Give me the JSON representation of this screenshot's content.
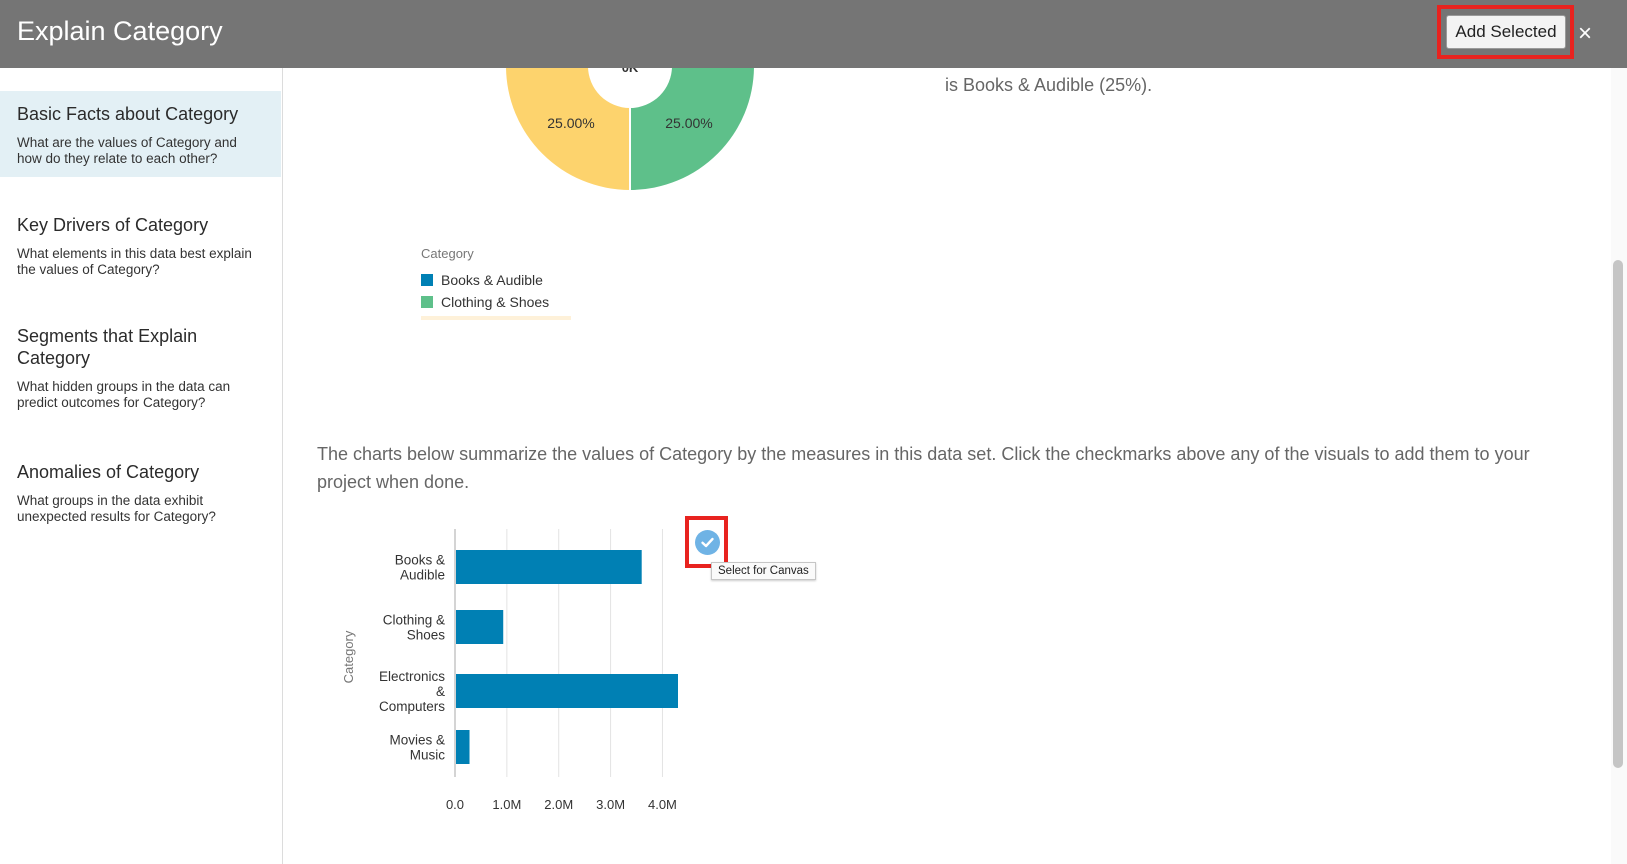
{
  "header": {
    "title": "Explain Category",
    "add_selected_label": "Add Selected",
    "close_label": "×"
  },
  "sidebar": {
    "items": [
      {
        "title": "Basic Facts about Category",
        "desc": "What are the values of Category and how do they relate to each other?",
        "active": true
      },
      {
        "title": "Key Drivers of Category",
        "desc": "What elements in this data best explain the values of Category?",
        "active": false
      },
      {
        "title": "Segments that Explain Category",
        "desc": "What hidden groups in the data can predict outcomes for Category?",
        "active": false
      },
      {
        "title": "Anomalies of Category",
        "desc": "What groups in the data exhibit unexpected results for Category?",
        "active": false
      }
    ]
  },
  "pie": {
    "center_label": "0K",
    "slice_labels": [
      "25.00%",
      "25.00%"
    ],
    "summary_text": "is Books & Audible (25%).",
    "legend_title": "Category",
    "legend": [
      {
        "label": "Books & Audible",
        "color": "#0080b4"
      },
      {
        "label": "Clothing & Shoes",
        "color": "#5ec08a"
      }
    ],
    "colors": {
      "yellow": "#fdd36d",
      "green": "#5ec08a"
    }
  },
  "description": "The charts below summarize the values of Category by the measures in this data set. Click the checkmarks above any of the visuals to add them to your project when done.",
  "select_tooltip": "Select for Canvas",
  "chart_data": {
    "type": "bar",
    "orientation": "horizontal",
    "categories": [
      "Books & Audible",
      "Clothing & Shoes",
      "Electronics & Computers",
      "Movies & Music"
    ],
    "category_label_lines": [
      [
        "Books &",
        "Audible"
      ],
      [
        "Clothing &",
        "Shoes"
      ],
      [
        "Electronics",
        "&",
        "Computers"
      ],
      [
        "Movies &",
        "Music"
      ]
    ],
    "values": [
      3.6,
      0.93,
      4.3,
      0.28
    ],
    "value_unit": "M",
    "ylabel": "Category",
    "xlim": [
      0,
      4.3
    ],
    "ticks": [
      "0.0",
      "1.0M",
      "2.0M",
      "3.0M",
      "4.0M"
    ],
    "tick_values": [
      0,
      1,
      2,
      3,
      4
    ],
    "bar_color": "#0080b4",
    "grid": true
  }
}
